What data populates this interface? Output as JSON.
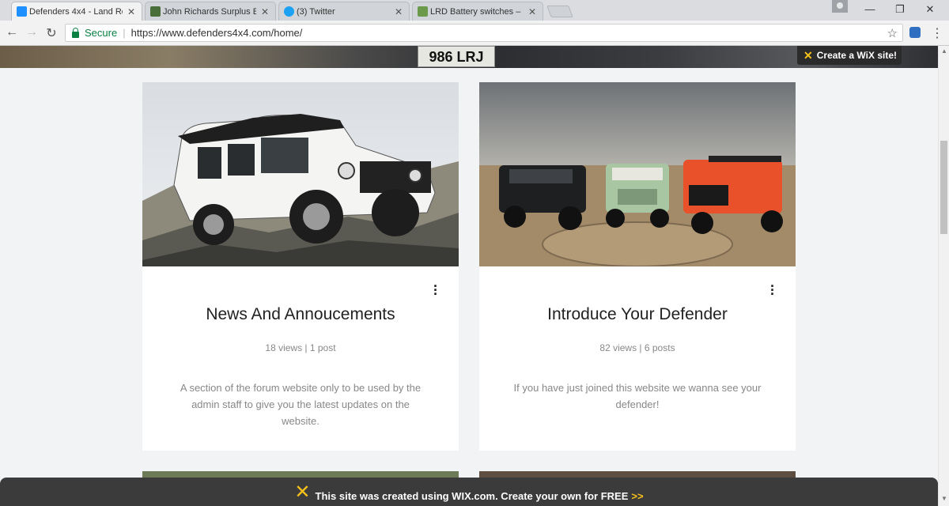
{
  "browser": {
    "tabs": [
      {
        "title": "Defenders 4x4 - Land Ro",
        "active": true,
        "favicon_color": "#1e90ff"
      },
      {
        "title": "John Richards Surplus Ex",
        "active": false,
        "favicon_color": "#4a6e3a"
      },
      {
        "title": "(3) Twitter",
        "active": false,
        "favicon_color": "#1da1f2"
      },
      {
        "title": "LRD Battery switches – L",
        "active": false,
        "favicon_color": "#6a9a4a"
      }
    ],
    "secure_label": "Secure",
    "url": "https://www.defenders4x4.com/home/"
  },
  "banner": {
    "plate_text": "986 LRJ"
  },
  "wix_badge": {
    "label": "Create a WiX site!"
  },
  "cards": [
    {
      "title": "News And Annoucements",
      "stats": "18 views | 1 post",
      "description": "A section of the forum website only to be used by the admin staff to give you the latest updates on the website."
    },
    {
      "title": "Introduce Your Defender",
      "stats": "82 views | 6 posts",
      "description": "If you have just joined this website we wanna see your defender!"
    }
  ],
  "footer": {
    "text": "This site was created using WIX.com. Create your own for FREE",
    "arrows": ">>"
  },
  "colors": {
    "wix_yellow": "#f9c21a",
    "secure_green": "#0b8043",
    "footer_bg": "#3b3b3b"
  }
}
